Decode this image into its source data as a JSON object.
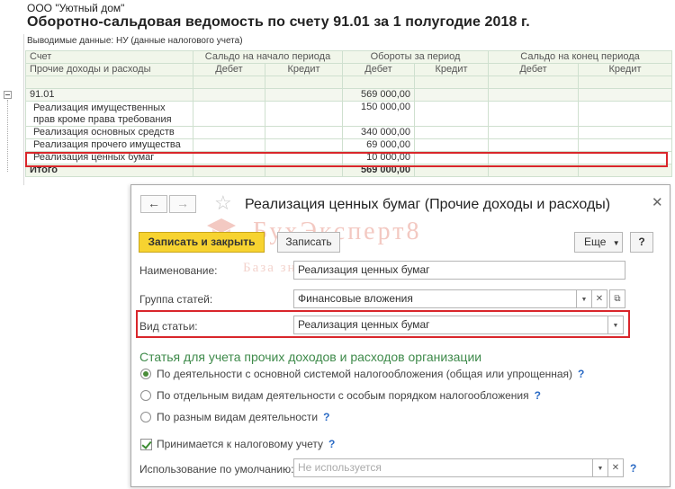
{
  "report": {
    "org": "ООО \"Уютный дом\"",
    "title": "Оборотно-сальдовая ведомость по счету 91.01 за 1 полугодие 2018 г.",
    "params": "Выводимые данные:  НУ (данные налогового учета)",
    "headers": {
      "account": "Счет",
      "subconto": "Прочие доходы и расходы",
      "opening": "Сальдо на начало периода",
      "turnover": "Обороты за период",
      "closing": "Сальдо на конец периода",
      "debit": "Дебет",
      "credit": "Кредит"
    },
    "rows": [
      {
        "name": "91.01",
        "turnover_debit": "569 000,00"
      },
      {
        "name": "Реализация имущественных прав кроме права требования",
        "turnover_debit": "150 000,00"
      },
      {
        "name": "Реализация основных средств",
        "turnover_debit": "340 000,00"
      },
      {
        "name": "Реализация прочего имущества",
        "turnover_debit": "69 000,00"
      },
      {
        "name": "Реализация ценных бумаг",
        "turnover_debit": "10 000,00"
      }
    ],
    "total": {
      "name": "Итого",
      "turnover_debit": "569 000,00"
    }
  },
  "dialog": {
    "back_icon": "arrow-left",
    "forward_icon": "arrow-right",
    "title": "Реализация ценных бумаг (Прочие доходы и расходы)",
    "watermark": "БухЭксперт8",
    "watermark_sub": "База знаний по учету в 1С",
    "save_close": "Записать и закрыть",
    "save": "Записать",
    "more": "Еще",
    "help": "?",
    "name_label": "Наименование:",
    "name_value": "Реализация ценных бумаг",
    "group_label": "Группа статей:",
    "group_value": "Финансовые вложения",
    "kind_label": "Вид статьи:",
    "kind_value": "Реализация ценных бумаг",
    "section_title": "Статья для учета прочих доходов и расходов организации",
    "radio_options": [
      "По деятельности с основной системой налогообложения (общая или упрощенная)",
      "По отдельным видам деятельности с особым порядком налогообложения",
      "По разным видам деятельности"
    ],
    "selected_radio": 0,
    "tax_checkbox": "Принимается к налоговому учету",
    "default_label": "Использование по умолчанию:",
    "default_placeholder": "Не используется"
  },
  "colors": {
    "highlight": "#d9262b",
    "primary_button": "#f7d330",
    "section_green": "#3e8a4a"
  }
}
